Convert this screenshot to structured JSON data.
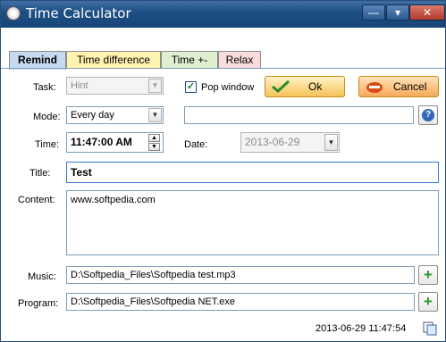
{
  "window": {
    "title": "Time Calculator",
    "controls": {
      "minimize": "—",
      "restore": "▾",
      "close": "✕"
    }
  },
  "tabs": [
    {
      "label": "Remind",
      "active": true,
      "color": "#c6d9f0"
    },
    {
      "label": "Time difference",
      "active": false,
      "color": "#fff3b0"
    },
    {
      "label": "Time +-",
      "active": false,
      "color": "#dff0d0"
    },
    {
      "label": "Relax",
      "active": false,
      "color": "#fadcdc"
    }
  ],
  "form": {
    "task_label": "Task:",
    "task_value": "Hint",
    "pop_window_label": "Pop window",
    "pop_window_checked": true,
    "ok_label": "Ok",
    "cancel_label": "Cancel",
    "mode_label": "Mode:",
    "mode_value": "Every day",
    "mode_extra_value": "",
    "time_label": "Time:",
    "time_value": "11:47:00 AM",
    "date_label": "Date:",
    "date_value": "2013-06-29",
    "title_label": "Title:",
    "title_value": "Test",
    "content_label": "Content:",
    "content_value": "www.softpedia.com",
    "music_label": "Music:",
    "music_value": "D:\\Softpedia_Files\\Softpedia test.mp3",
    "program_label": "Program:",
    "program_value": "D:\\Softpedia_Files\\Softpedia NET.exe"
  },
  "status": {
    "timestamp": "2013-06-29 11:47:54"
  },
  "icons": {
    "app": "clock-icon",
    "help": "help-icon",
    "copy": "copy-icon",
    "ok": "check-icon",
    "cancel": "cancel-icon",
    "plus": "plus-icon"
  }
}
